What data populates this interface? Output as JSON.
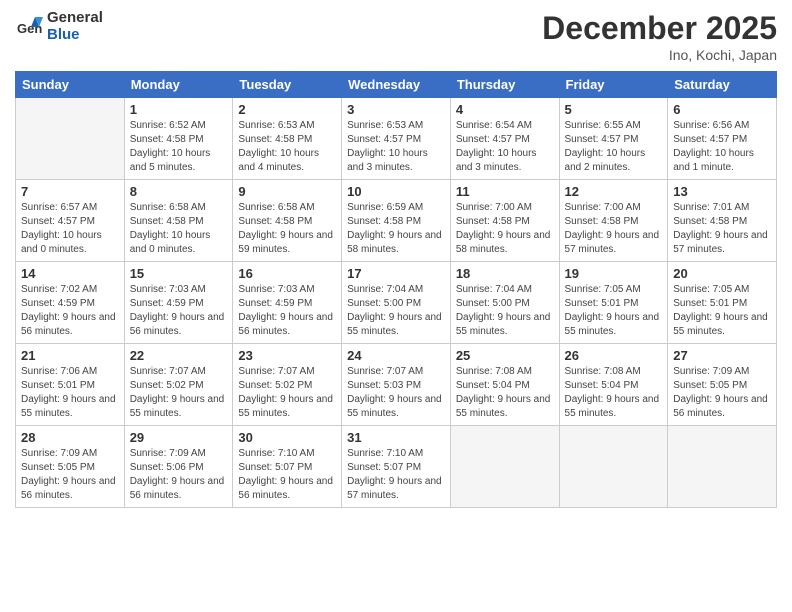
{
  "logo": {
    "line1": "General",
    "line2": "Blue"
  },
  "title": "December 2025",
  "subtitle": "Ino, Kochi, Japan",
  "header_days": [
    "Sunday",
    "Monday",
    "Tuesday",
    "Wednesday",
    "Thursday",
    "Friday",
    "Saturday"
  ],
  "weeks": [
    [
      {
        "num": "",
        "info": ""
      },
      {
        "num": "1",
        "info": "Sunrise: 6:52 AM\nSunset: 4:58 PM\nDaylight: 10 hours\nand 5 minutes."
      },
      {
        "num": "2",
        "info": "Sunrise: 6:53 AM\nSunset: 4:58 PM\nDaylight: 10 hours\nand 4 minutes."
      },
      {
        "num": "3",
        "info": "Sunrise: 6:53 AM\nSunset: 4:57 PM\nDaylight: 10 hours\nand 3 minutes."
      },
      {
        "num": "4",
        "info": "Sunrise: 6:54 AM\nSunset: 4:57 PM\nDaylight: 10 hours\nand 3 minutes."
      },
      {
        "num": "5",
        "info": "Sunrise: 6:55 AM\nSunset: 4:57 PM\nDaylight: 10 hours\nand 2 minutes."
      },
      {
        "num": "6",
        "info": "Sunrise: 6:56 AM\nSunset: 4:57 PM\nDaylight: 10 hours\nand 1 minute."
      }
    ],
    [
      {
        "num": "7",
        "info": "Sunrise: 6:57 AM\nSunset: 4:57 PM\nDaylight: 10 hours\nand 0 minutes."
      },
      {
        "num": "8",
        "info": "Sunrise: 6:58 AM\nSunset: 4:58 PM\nDaylight: 10 hours\nand 0 minutes."
      },
      {
        "num": "9",
        "info": "Sunrise: 6:58 AM\nSunset: 4:58 PM\nDaylight: 9 hours\nand 59 minutes."
      },
      {
        "num": "10",
        "info": "Sunrise: 6:59 AM\nSunset: 4:58 PM\nDaylight: 9 hours\nand 58 minutes."
      },
      {
        "num": "11",
        "info": "Sunrise: 7:00 AM\nSunset: 4:58 PM\nDaylight: 9 hours\nand 58 minutes."
      },
      {
        "num": "12",
        "info": "Sunrise: 7:00 AM\nSunset: 4:58 PM\nDaylight: 9 hours\nand 57 minutes."
      },
      {
        "num": "13",
        "info": "Sunrise: 7:01 AM\nSunset: 4:58 PM\nDaylight: 9 hours\nand 57 minutes."
      }
    ],
    [
      {
        "num": "14",
        "info": "Sunrise: 7:02 AM\nSunset: 4:59 PM\nDaylight: 9 hours\nand 56 minutes."
      },
      {
        "num": "15",
        "info": "Sunrise: 7:03 AM\nSunset: 4:59 PM\nDaylight: 9 hours\nand 56 minutes."
      },
      {
        "num": "16",
        "info": "Sunrise: 7:03 AM\nSunset: 4:59 PM\nDaylight: 9 hours\nand 56 minutes."
      },
      {
        "num": "17",
        "info": "Sunrise: 7:04 AM\nSunset: 5:00 PM\nDaylight: 9 hours\nand 55 minutes."
      },
      {
        "num": "18",
        "info": "Sunrise: 7:04 AM\nSunset: 5:00 PM\nDaylight: 9 hours\nand 55 minutes."
      },
      {
        "num": "19",
        "info": "Sunrise: 7:05 AM\nSunset: 5:01 PM\nDaylight: 9 hours\nand 55 minutes."
      },
      {
        "num": "20",
        "info": "Sunrise: 7:05 AM\nSunset: 5:01 PM\nDaylight: 9 hours\nand 55 minutes."
      }
    ],
    [
      {
        "num": "21",
        "info": "Sunrise: 7:06 AM\nSunset: 5:01 PM\nDaylight: 9 hours\nand 55 minutes."
      },
      {
        "num": "22",
        "info": "Sunrise: 7:07 AM\nSunset: 5:02 PM\nDaylight: 9 hours\nand 55 minutes."
      },
      {
        "num": "23",
        "info": "Sunrise: 7:07 AM\nSunset: 5:02 PM\nDaylight: 9 hours\nand 55 minutes."
      },
      {
        "num": "24",
        "info": "Sunrise: 7:07 AM\nSunset: 5:03 PM\nDaylight: 9 hours\nand 55 minutes."
      },
      {
        "num": "25",
        "info": "Sunrise: 7:08 AM\nSunset: 5:04 PM\nDaylight: 9 hours\nand 55 minutes."
      },
      {
        "num": "26",
        "info": "Sunrise: 7:08 AM\nSunset: 5:04 PM\nDaylight: 9 hours\nand 55 minutes."
      },
      {
        "num": "27",
        "info": "Sunrise: 7:09 AM\nSunset: 5:05 PM\nDaylight: 9 hours\nand 56 minutes."
      }
    ],
    [
      {
        "num": "28",
        "info": "Sunrise: 7:09 AM\nSunset: 5:05 PM\nDaylight: 9 hours\nand 56 minutes."
      },
      {
        "num": "29",
        "info": "Sunrise: 7:09 AM\nSunset: 5:06 PM\nDaylight: 9 hours\nand 56 minutes."
      },
      {
        "num": "30",
        "info": "Sunrise: 7:10 AM\nSunset: 5:07 PM\nDaylight: 9 hours\nand 56 minutes."
      },
      {
        "num": "31",
        "info": "Sunrise: 7:10 AM\nSunset: 5:07 PM\nDaylight: 9 hours\nand 57 minutes."
      },
      {
        "num": "",
        "info": ""
      },
      {
        "num": "",
        "info": ""
      },
      {
        "num": "",
        "info": ""
      }
    ]
  ]
}
